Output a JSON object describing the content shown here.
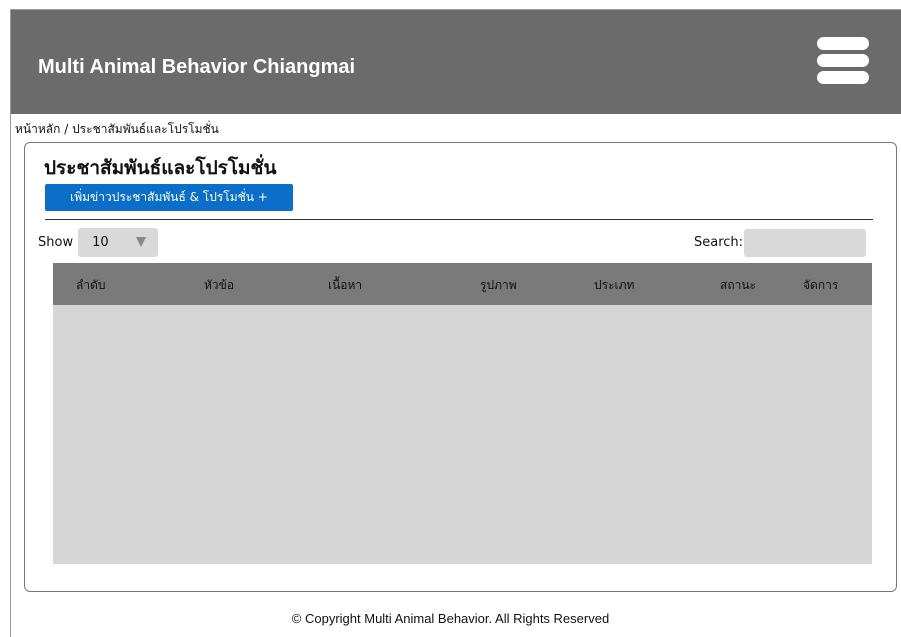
{
  "header": {
    "brand": "Multi Animal Behavior Chiangmai",
    "menu_icon": "hamburger-menu-icon"
  },
  "breadcrumb": {
    "home": "หน้าหลัก",
    "separator": " / ",
    "current": "ประชาสัมพันธ์และโปรโมชั่น"
  },
  "page": {
    "title": "ประชาสัมพันธ์และโปรโมชั่น",
    "add_button": "เพิ่มข่าวประชาสัมพันธ์ & โปรโมชั่น +"
  },
  "controls": {
    "show_label": "Show",
    "show_value": "10",
    "search_label": "Search:",
    "search_value": ""
  },
  "table": {
    "columns": [
      "ลำดับ",
      "หัวข้อ",
      "เนื้อหา",
      "รูปภาพ",
      "ประเภท",
      "สถานะ",
      "จัดการ"
    ],
    "rows": []
  },
  "footer": {
    "text": "© Copyright Multi Animal Behavior. All Rights Reserved"
  },
  "colors": {
    "header_bg": "#6b6b6b",
    "accent": "#0b6fca",
    "table_head": "#7a7a7a",
    "table_body": "#d6d6d6"
  }
}
